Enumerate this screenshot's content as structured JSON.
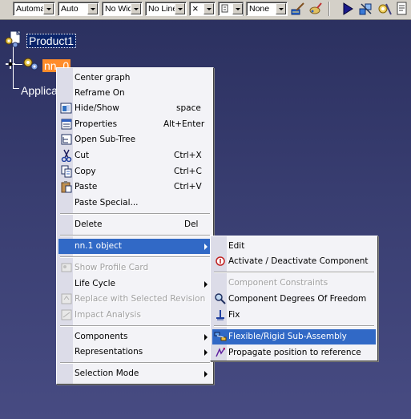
{
  "toolbar": {
    "combo1": "Automa",
    "combo2": "Auto",
    "combo3": "No Wid",
    "combo4": "No Line",
    "combo5": "×",
    "combo6": "",
    "combo7": "None"
  },
  "tree": {
    "root": "Product1",
    "child": "nn_0",
    "applications": "Applica"
  },
  "context_menu": {
    "center_graph": "Center graph",
    "reframe_on": "Reframe On",
    "hide_show": "Hide/Show",
    "hide_show_key": "space",
    "properties": "Properties",
    "properties_key": "Alt+Enter",
    "open_subtree": "Open Sub-Tree",
    "cut": "Cut",
    "cut_key": "Ctrl+X",
    "copy": "Copy",
    "copy_key": "Ctrl+C",
    "paste": "Paste",
    "paste_key": "Ctrl+V",
    "paste_special": "Paste Special...",
    "delete": "Delete",
    "delete_key": "Del",
    "object": "nn.1 object",
    "show_profile_card": "Show Profile Card",
    "life_cycle": "Life Cycle",
    "replace_revision": "Replace with Selected Revision",
    "impact_analysis": "Impact Analysis",
    "components": "Components",
    "representations": "Representations",
    "selection_mode": "Selection Mode"
  },
  "submenu": {
    "edit": "Edit",
    "activate": "Activate / Deactivate Component",
    "constraints": "Component Constraints",
    "dof": "Component Degrees Of Freedom",
    "fix": "Fix",
    "flexible": "Flexible/Rigid Sub-Assembly",
    "propagate": "Propagate position to reference"
  },
  "colors": {
    "background": "#383d70",
    "selection": "#3169c6",
    "node_highlight": "#ff8c2a"
  }
}
